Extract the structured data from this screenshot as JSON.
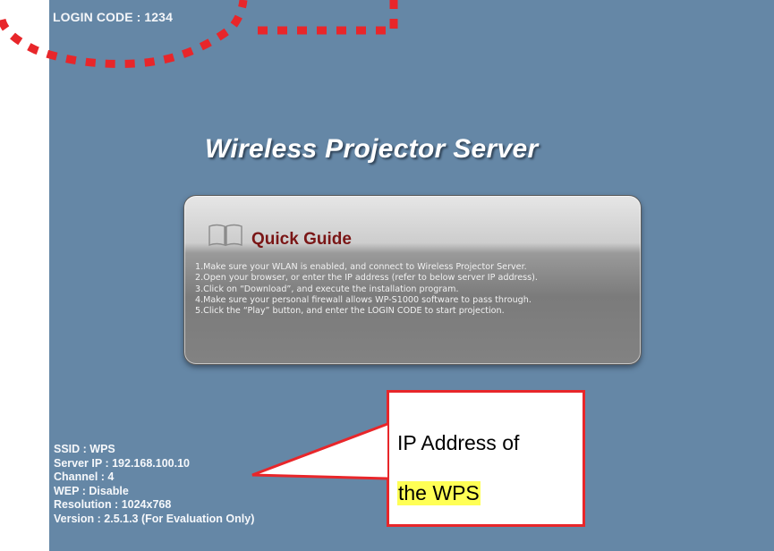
{
  "login": {
    "label": "LOGIN CODE : 1234"
  },
  "header": {
    "title": "Wireless Projector Server"
  },
  "quick_guide": {
    "title": "Quick Guide",
    "steps": [
      "1.Make sure your WLAN is enabled, and connect to Wireless Projector Server.",
      "2.Open your browser, or enter the IP address (refer to below server IP address).",
      "3.Click on “Download”, and execute the installation program.",
      "4.Make sure your personal firewall allows WP-S1000 software to pass through.",
      "5.Click the “Play” button, and enter the LOGIN CODE to start projection."
    ]
  },
  "server_info": {
    "ssid": "SSID : WPS",
    "server_ip": "Server IP : 192.168.100.10",
    "channel": "Channel : 4",
    "wep": "WEP : Disable",
    "resolution": "Resolution : 1024x768",
    "version": "Version : 2.5.1.3 (For Evaluation Only)"
  },
  "callout": {
    "line1": "IP Address of",
    "line2": "the WPS"
  },
  "colors": {
    "screen_background": "#6587a6",
    "guide_title": "#7a1616",
    "annotation_red": "#e8262a",
    "highlight_yellow": "#ffff55"
  },
  "icons": {
    "guide_icon": "open-book-icon"
  }
}
